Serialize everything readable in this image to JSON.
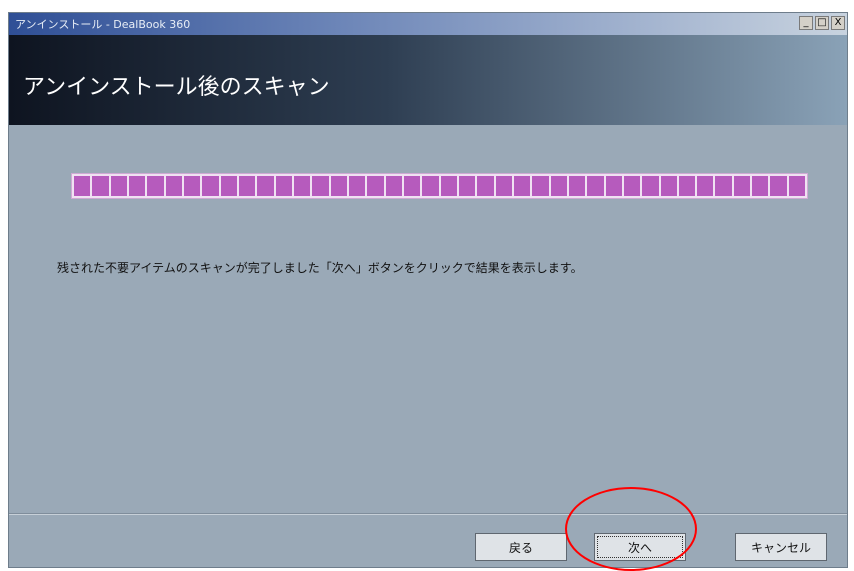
{
  "window": {
    "title": "アンインストール - DealBook 360",
    "buttons": [
      "_",
      "□",
      "X"
    ]
  },
  "header": {
    "title": "アンインストール後のスキャン"
  },
  "progress": {
    "fraction": 1.0,
    "segments": 40,
    "fill_color": "#b65bbd",
    "track_color": "#f0e2f2"
  },
  "message": "残された不要アイテムのスキャンが完了しました「次へ」ボタンをクリックで結果を表示します。",
  "buttons": {
    "back": "戻る",
    "next": "次へ",
    "cancel": "キャンセル"
  },
  "annotation": {
    "highlight_color": "#ff0000"
  }
}
